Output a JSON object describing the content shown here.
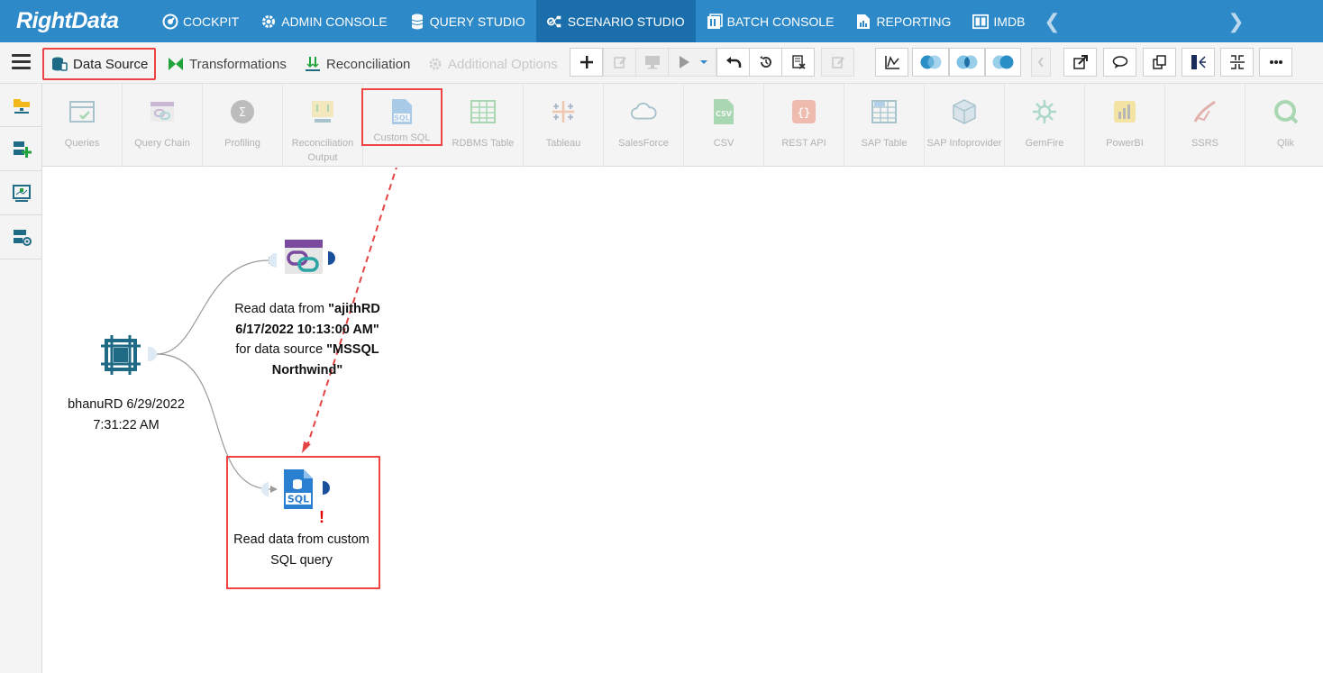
{
  "brand": {
    "logo": "RightData"
  },
  "topnav": {
    "items": [
      {
        "label": "COCKPIT"
      },
      {
        "label": "ADMIN CONSOLE"
      },
      {
        "label": "QUERY STUDIO"
      },
      {
        "label": "SCENARIO STUDIO"
      },
      {
        "label": "BATCH CONSOLE"
      },
      {
        "label": "REPORTING"
      },
      {
        "label": "IMDB"
      }
    ],
    "active": "SCENARIO STUDIO"
  },
  "tabs": {
    "data_source": "Data Source",
    "transformations": "Transformations",
    "reconciliation": "Reconciliation",
    "additional_options": "Additional Options"
  },
  "ribbon": {
    "items": [
      {
        "label": "Queries"
      },
      {
        "label": "Query Chain"
      },
      {
        "label": "Profiling"
      },
      {
        "label": "Reconciliation Output"
      },
      {
        "label": "Custom SQL"
      },
      {
        "label": "RDBMS Table"
      },
      {
        "label": "Tableau"
      },
      {
        "label": "SalesForce"
      },
      {
        "label": "CSV"
      },
      {
        "label": "REST API"
      },
      {
        "label": "SAP Table"
      },
      {
        "label": "SAP Infoprovider"
      },
      {
        "label": "GemFire"
      },
      {
        "label": "PowerBI"
      },
      {
        "label": "SSRS"
      },
      {
        "label": "Qlik"
      }
    ]
  },
  "canvas": {
    "source_node": {
      "line1": "bhanuRD 6/29/2022",
      "line2": "7:31:22 AM"
    },
    "query_chain_node": {
      "prefix": "Read data from ",
      "name_line1": "\"ajithRD",
      "name_line2": "6/17/2022 10:13:00 AM\"",
      "middle": "for data source ",
      "ds_line1": "\"MSSQL",
      "ds_line2": "Northwind\""
    },
    "custom_sql_node": {
      "line1": "Read data from custom",
      "line2": "SQL query",
      "warning": "!",
      "icon_text": "SQL"
    }
  },
  "colors": {
    "nav_bg": "#2d89c8",
    "nav_active": "#1a6eac",
    "highlight": "#e44444",
    "node_teal": "#1f6b85"
  }
}
